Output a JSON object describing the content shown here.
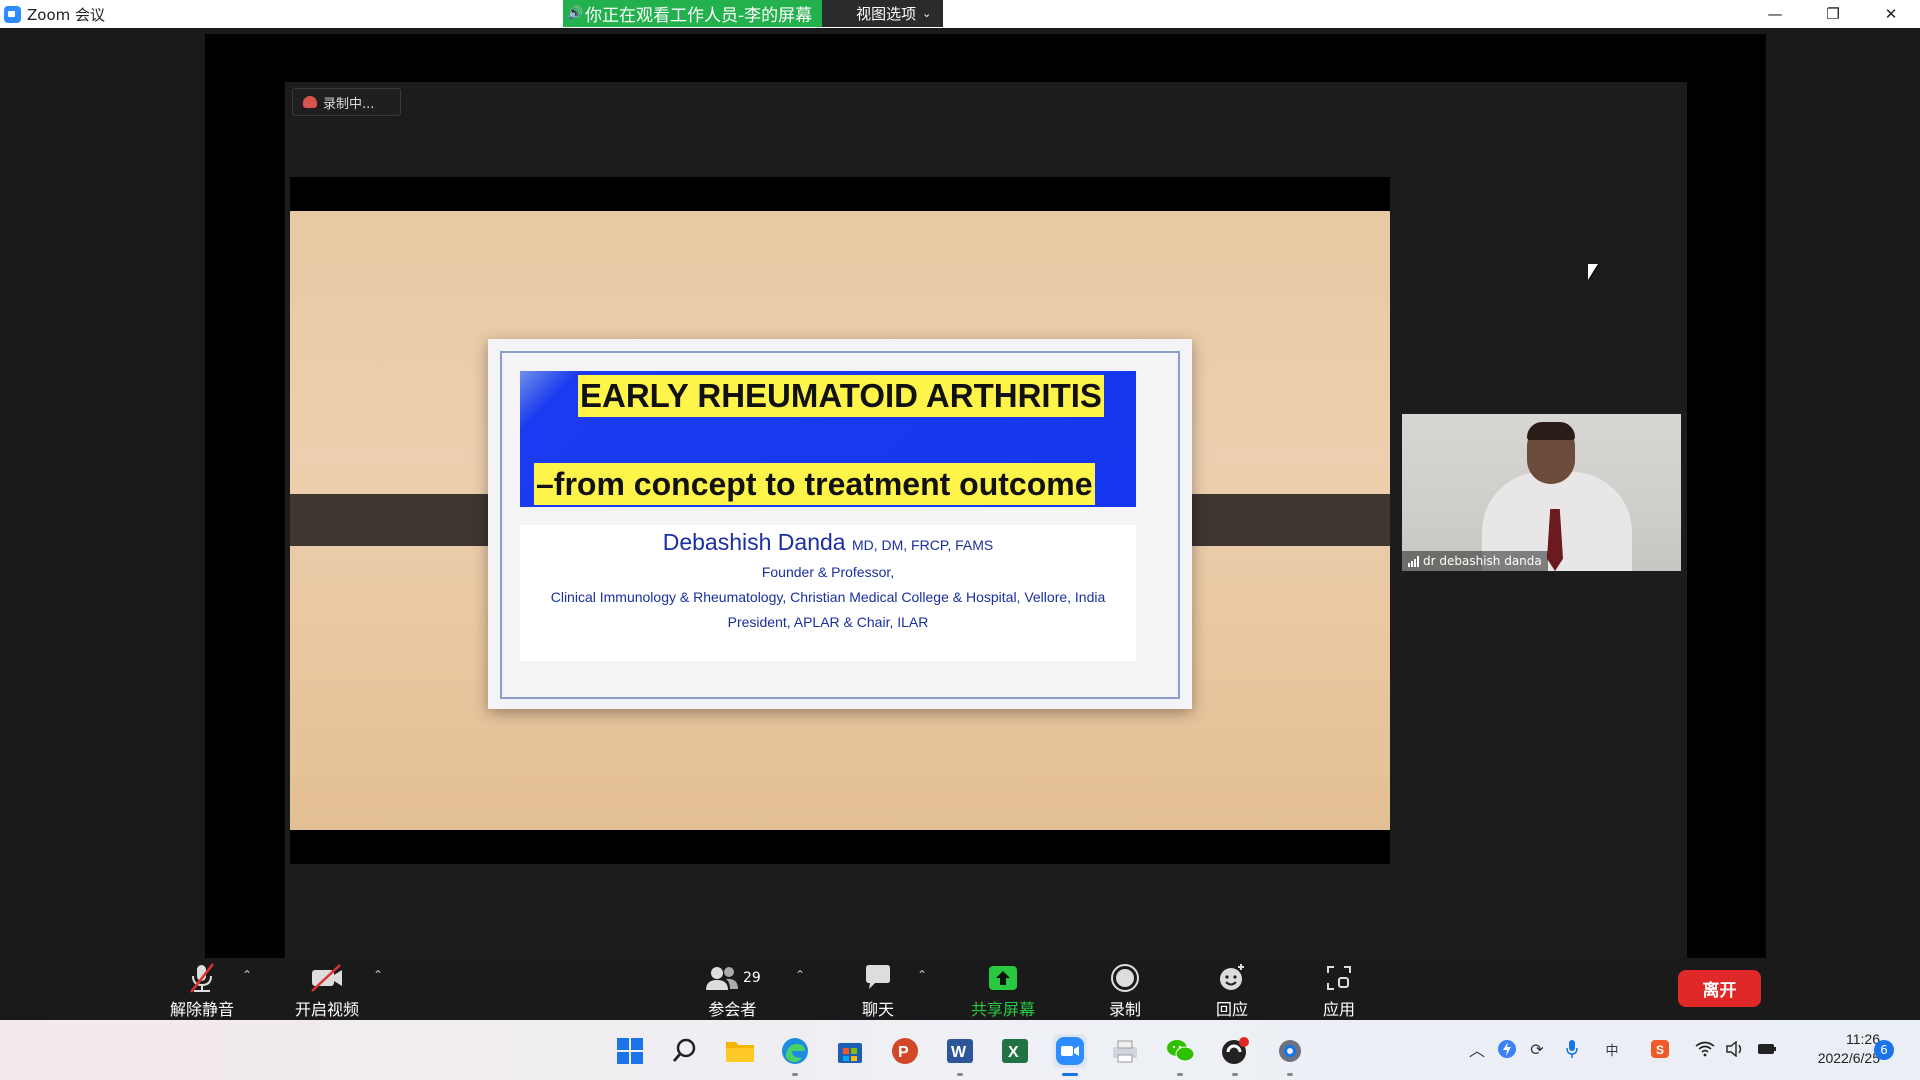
{
  "window": {
    "title": "Zoom 会议"
  },
  "share_banner": {
    "text": "你正在观看工作人员-李的屏幕",
    "view_options": "视图选项"
  },
  "recording_badge": {
    "text": "录制中..."
  },
  "slide": {
    "title_line1": "EARLY RHEUMATOID ARTHRITIS",
    "title_line2": "–from concept to treatment outcome",
    "author_name": "Debashish Danda",
    "author_credentials": "MD, DM, FRCP, FAMS",
    "role": "Founder & Professor,",
    "department": "Clinical Immunology & Rheumatology, Christian Medical College & Hospital, Vellore, India",
    "position": "President, APLAR & Chair, ILAR"
  },
  "participant_video": {
    "name": "dr debashish danda"
  },
  "toolbar": {
    "unmute": "解除静音",
    "start_video": "开启视频",
    "participants": "参会者",
    "participants_count": "29",
    "chat": "聊天",
    "share_screen": "共享屏幕",
    "record": "录制",
    "reactions": "回应",
    "apps": "应用",
    "leave": "离开"
  },
  "taskbar": {
    "time": "11:26",
    "date": "2022/6/25",
    "notification_count": "6"
  },
  "colors": {
    "share_green": "#23b14d",
    "leave_red": "#e02828",
    "slide_title_bg": "#1437ef",
    "highlight_yellow": "#fff44a"
  }
}
